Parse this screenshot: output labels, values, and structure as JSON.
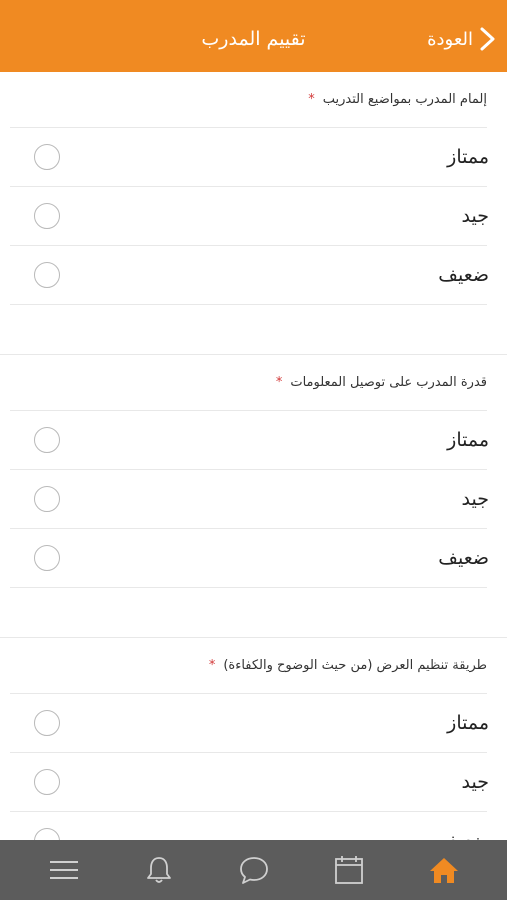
{
  "header": {
    "title": "تقييم المدرب",
    "back_label": "العودة"
  },
  "questions": [
    {
      "label": "إلمام المدرب بمواضيع التدريب",
      "required_mark": "*",
      "options": [
        "ممتاز",
        "جيد",
        "ضعيف"
      ]
    },
    {
      "label": "قدرة المدرب على توصيل المعلومات",
      "required_mark": "*",
      "options": [
        "ممتاز",
        "جيد",
        "ضعيف"
      ]
    },
    {
      "label": "طريقة تنظيم العرض (من حيث الوضوح والكفاءة)",
      "required_mark": "*",
      "options": [
        "ممتاز",
        "جيد",
        "ضعيف"
      ]
    }
  ],
  "tabbar": {
    "items": [
      "menu-icon",
      "bell-icon",
      "chat-icon",
      "calendar-icon",
      "home-icon"
    ],
    "active": "home-icon"
  },
  "colors": {
    "accent": "#f08a22",
    "tabbar_bg": "#5c5c5c",
    "required": "#d23838"
  }
}
